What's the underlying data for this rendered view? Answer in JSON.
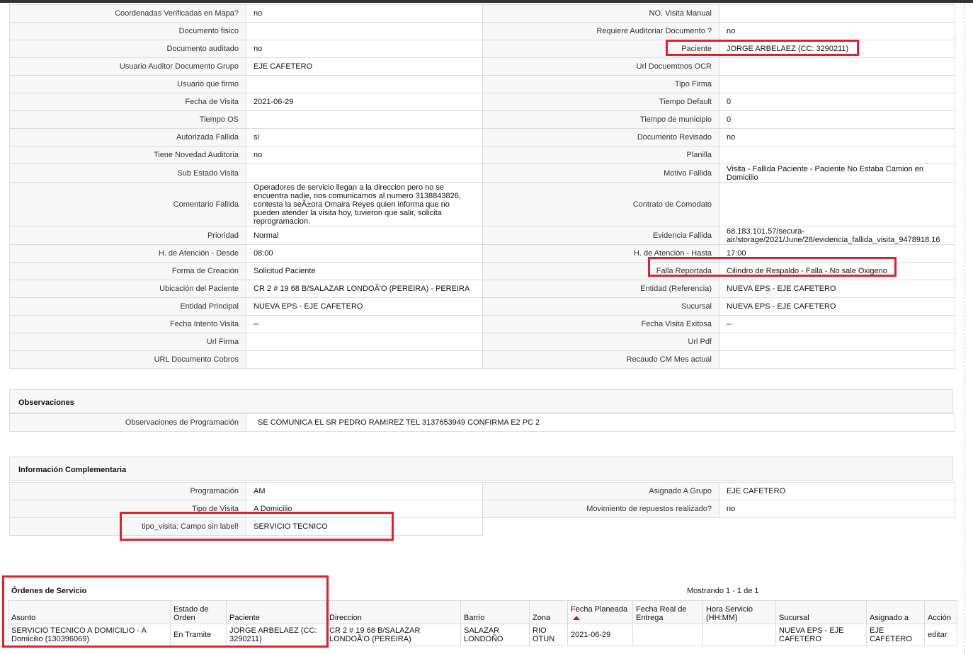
{
  "detail_rows": [
    {
      "l1": "Coordenadas Verificadas en Mapa?",
      "v1": "no",
      "l2": "NO. Visita Manual",
      "v2": ""
    },
    {
      "l1": "Documento fisico",
      "v1": "",
      "l2": "Requiere Auditoriar Documento ?",
      "v2": "no"
    },
    {
      "l1": "Documento auditado",
      "v1": "no",
      "l2": "Paciente",
      "v2": "JORGE ARBELAEZ (CC: 3290211)"
    },
    {
      "l1": "Usuario Auditor Documento Grupo",
      "v1": "EJE CAFETERO",
      "l2": "Url Docuemtnos OCR",
      "v2": ""
    },
    {
      "l1": "Usuario que firmo",
      "v1": "",
      "l2": "Tipo Firma",
      "v2": ""
    },
    {
      "l1": "Fecha de Visita",
      "v1": "2021-06-29",
      "l2": "Tiempo Default",
      "v2": "0"
    },
    {
      "l1": "Tiempo OS",
      "v1": "",
      "l2": "Tiempo de municipio",
      "v2": "0"
    },
    {
      "l1": "Autorizada Fallida",
      "v1": "si",
      "l2": "Documento Revisado",
      "v2": "no"
    },
    {
      "l1": "Tiene Novedad Auditoria",
      "v1": "no",
      "l2": "Planilla",
      "v2": ""
    },
    {
      "l1": "Sub Estado Visita",
      "v1": "",
      "l2": "Motivo Fallida",
      "v2": "Visita - Fallida Paciente - Paciente No Estaba Camion en Domicilio"
    },
    {
      "l1": "Comentario Fallida",
      "v1": "Operadores de servicio llegan a la direccion pero no se encuentra nadie, nos comunicamos al numero 3138843826, contesta la seÃ±ora Omaira Reyes quien informa que no pueden atender la visita hoy, tuvieron que salir, solicita reprogramacion.",
      "l2": "Contrato de Comodato",
      "v2": ""
    },
    {
      "l1": "Prioridad",
      "v1": "Normal",
      "l2": "Evidencia Fallida",
      "v2": "68.183.101.57/secura-air/storage/2021/June/28/evidencia_fallida_visita_9478918.16"
    },
    {
      "l1": "H. de Atención - Desde",
      "v1": "08:00",
      "l2": "H. de Atención - Hasta",
      "v2": "17:00"
    },
    {
      "l1": "Forma de Creación",
      "v1": "Solicitud Paciente",
      "l2": "Falla Reportada",
      "v2": "Cilindro de Respaldo - Falla - No sale Oxigeno"
    },
    {
      "l1": "Ubicación del Paciente",
      "v1": "CR 2 # 19 68 B/SALAZAR LONDOÃ'O (PEREIRA) - PEREIRA",
      "l2": "Entidad (Referencia)",
      "v2": "NUEVA EPS - EJE CAFETERO"
    },
    {
      "l1": "Entidad Principal",
      "v1": "NUEVA EPS - EJE CAFETERO",
      "l2": "Sucursal",
      "v2": "NUEVA EPS - EJE CAFETERO"
    },
    {
      "l1": "Fecha Intento Visita",
      "v1": "--",
      "l2": "Fecha Visita Exitosa",
      "v2": "--"
    },
    {
      "l1": "Url Firma",
      "v1": "",
      "l2": "Url Pdf",
      "v2": ""
    },
    {
      "l1": "URL Documento Cobros",
      "v1": "",
      "l2": "Recaudo CM Mes actual",
      "v2": ""
    }
  ],
  "observaciones": {
    "title": "Observaciones",
    "label": "Observaciones de Programación",
    "value": "SE COMUNICA EL SR PEDRO RAMIREZ TEL 3137653949 CONFIRMA E2 PC 2"
  },
  "complementaria": {
    "title": "Información Complementaria",
    "rows": [
      {
        "l1": "Programación",
        "v1": "AM",
        "l2": "Asignado A Grupo",
        "v2": "EJE CAFETERO"
      },
      {
        "l1": "Tipo de Visita",
        "v1": "A Domicilio",
        "l2": "Movimiento de repuestos realizado?",
        "v2": "no"
      }
    ],
    "extra": {
      "label": "tipo_visita: Campo sin label!",
      "value": "SERVICIO TECNICO"
    }
  },
  "ordenes": {
    "title": "Órdenes de Servicio",
    "count": "Mostrando 1 - 1 de 1",
    "columns": [
      "Asunto",
      "Estado de Orden",
      "Paciente",
      "Direccion",
      "Barrio",
      "Zona",
      "Fecha Planeada",
      "Fecha Real de Entrega",
      "Hora Servicio (HH:MM)",
      "Sucursal",
      "Asignado a",
      "Acción"
    ],
    "rows": [
      [
        "SERVICIO TECNICO A DOMICILIO - A Domicilio (130396069)",
        "En Tramite",
        "JORGE ARBELAEZ (CC: 3290211)",
        "CR 2 # 19 68 B/SALAZAR LONDOÃ'O (PEREIRA)",
        "SALAZAR LONDOÑO",
        "RIO OTUN",
        "2021-06-29",
        "",
        "",
        "NUEVA EPS - EJE CAFETERO",
        "EJE CAFETERO",
        "editar"
      ]
    ]
  },
  "colors": {
    "highlight": "#e0202a",
    "label_bg": "#f7f7f7",
    "border": "#dcdcdc"
  }
}
